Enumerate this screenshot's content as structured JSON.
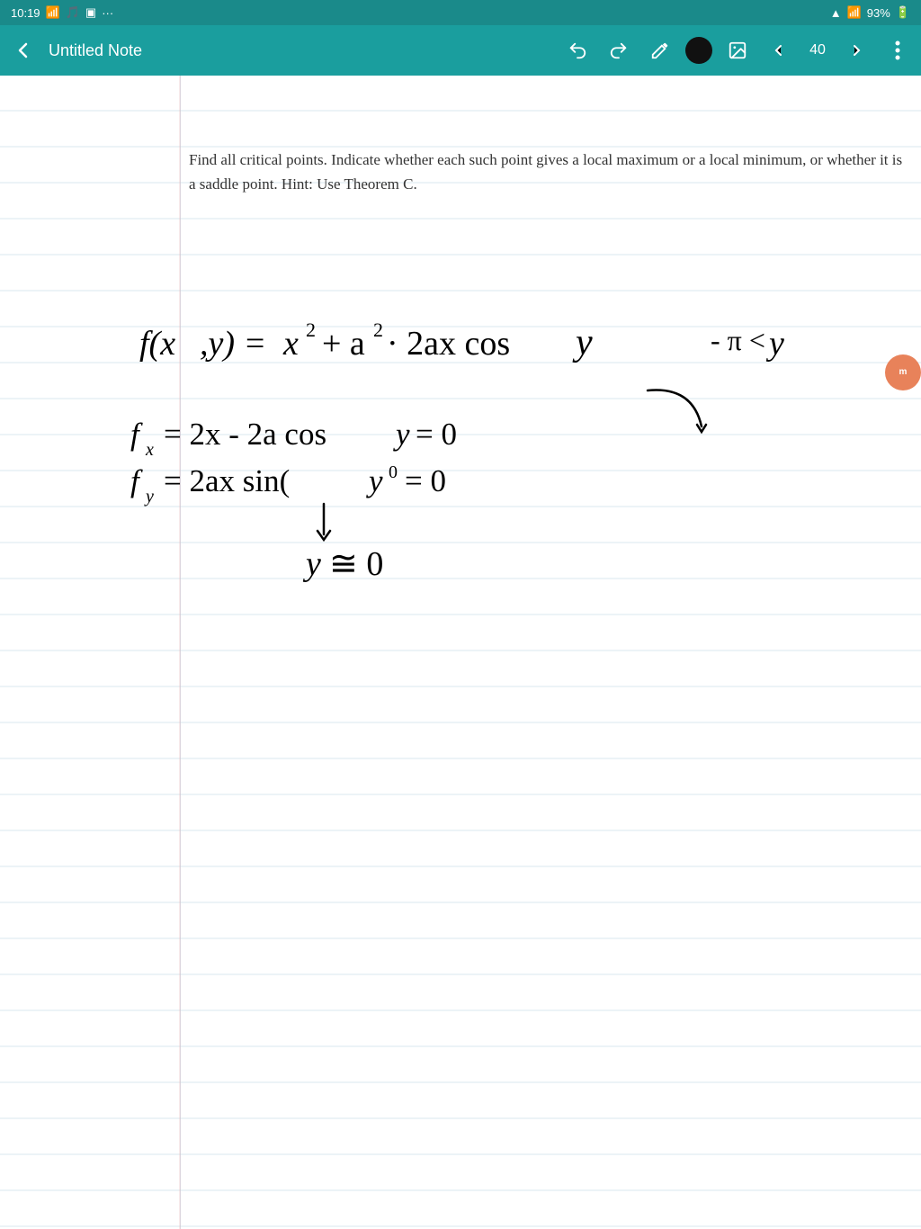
{
  "status_bar": {
    "time": "10:19",
    "battery": "93%",
    "icons": [
      "signal",
      "wifi",
      "battery"
    ]
  },
  "toolbar": {
    "back_icon": "←",
    "title": "Untitled Note",
    "undo_icon": "↩",
    "redo_icon": "↪",
    "pen_icon": "✏",
    "color_icon": "circle",
    "image_icon": "🖼",
    "prev_icon": "<",
    "page_number": "40",
    "next_icon": ">",
    "more_icon": "⋮"
  },
  "note": {
    "problem_text": "Find all critical points. Indicate whether each such point gives a local maximum or a local minimum, or whether it is a saddle point. Hint: Use Theorem C."
  },
  "profile": {
    "initials": "m"
  }
}
